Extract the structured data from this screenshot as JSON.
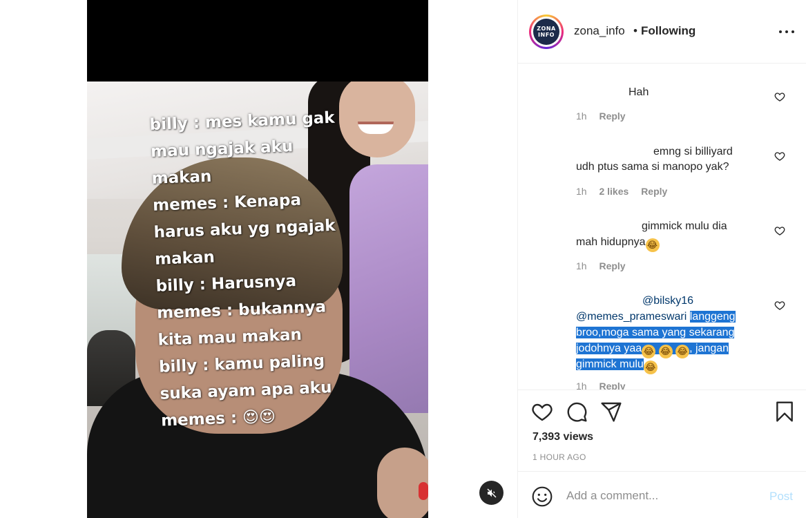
{
  "video": {
    "overlay_lines": [
      "billy : mes kamu gak",
      "mau ngajak aku",
      "makan",
      "memes : Kenapa",
      "harus aku yg ngajak",
      "makan",
      "billy : Harusnya",
      "memes : bukannya",
      "kita mau makan",
      "billy : kamu paling",
      "suka ayam apa aku",
      "memes : 😍😍"
    ],
    "mute_icon": "muted-speaker-icon"
  },
  "header": {
    "avatar_text_line1": "ZONA",
    "avatar_text_line2": "INFO",
    "username": "zona_info",
    "separator": "•",
    "follow_status": "Following",
    "more_icon": "more-options-icon"
  },
  "comments": [
    {
      "text": "Hah",
      "time": "1h",
      "likes": "",
      "reply": "Reply"
    },
    {
      "text": "emng si billiyard udh ptus sama si manopo yak?",
      "line1": "emng si billiyard",
      "line2": "udh ptus sama si manopo yak?",
      "time": "1h",
      "likes": "2 likes",
      "reply": "Reply"
    },
    {
      "line1": "gimmick mulu dia",
      "line2": "mah hidupnya",
      "emoji": "😂",
      "time": "1h",
      "reply": "Reply"
    },
    {
      "mention1": "@bilsky16",
      "mention2": "@memes_prameswari",
      "text_part1": "langgeng",
      "line2": "broo,moga sama yang sekarang",
      "line3": "jodohnya yaa",
      "emoji": "😂",
      "line3_tail": ", jangan",
      "line4": "gimmick mulu",
      "time": "1h",
      "reply": "Reply"
    }
  ],
  "actions": {
    "like_icon": "heart-icon",
    "comment_icon": "comment-icon",
    "share_icon": "share-icon",
    "save_icon": "bookmark-icon",
    "views": "7,393 views",
    "time_ago": "1 HOUR AGO"
  },
  "add_comment": {
    "emoji_icon": "smiley-icon",
    "placeholder": "Add a comment...",
    "post_label": "Post"
  },
  "colors": {
    "link": "#00376b",
    "muted": "#8e8e8e",
    "post_disabled": "#b2dffc",
    "selection": "#1e74d3"
  }
}
